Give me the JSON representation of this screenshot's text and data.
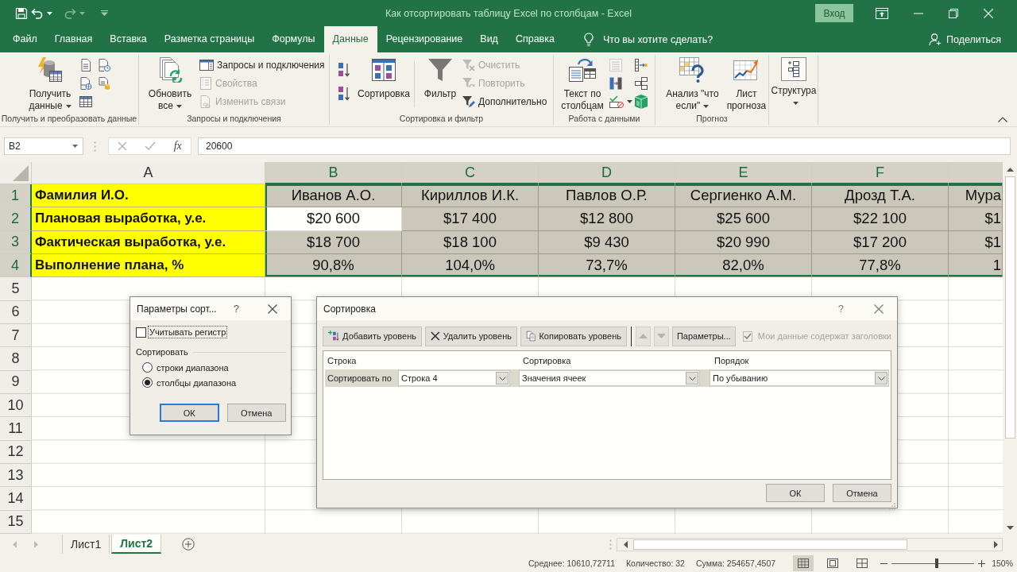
{
  "window": {
    "title": "Как отсортировать таблицу Excel по столбцам - Excel",
    "sign_in": "Вход"
  },
  "quick_access": [
    {
      "kind": "save",
      "disabled": false
    },
    {
      "kind": "undo",
      "disabled": false
    },
    {
      "kind": "redo",
      "disabled": true
    }
  ],
  "tabs": [
    {
      "label": "Файл",
      "selected": false
    },
    {
      "label": "Главная",
      "selected": false
    },
    {
      "label": "Вставка",
      "selected": false
    },
    {
      "label": "Разметка страницы",
      "selected": false
    },
    {
      "label": "Формулы",
      "selected": false
    },
    {
      "label": "Данные",
      "selected": true
    },
    {
      "label": "Рецензирование",
      "selected": false
    },
    {
      "label": "Вид",
      "selected": false
    },
    {
      "label": "Справка",
      "selected": false
    }
  ],
  "tell_me": {
    "placeholder": "Что вы хотите сделать?"
  },
  "share": "Поделиться",
  "ribbon": [
    {
      "label": "Получить и преобразовать данные",
      "buttons": [
        {
          "label": "Получить данные",
          "caret": true,
          "disabled": false
        }
      ]
    },
    {
      "label": "Запросы и подключения",
      "buttons": [
        {
          "label": "Обновить все",
          "caret": true,
          "disabled": false
        },
        {
          "label": "Запросы и подключения",
          "caret": false,
          "disabled": false
        },
        {
          "label": "Свойства",
          "caret": false,
          "disabled": true
        },
        {
          "label": "Изменить связи",
          "caret": false,
          "disabled": true
        }
      ]
    },
    {
      "label": "Сортировка и фильтр",
      "buttons": [
        {
          "label": "Сортировка",
          "caret": false,
          "disabled": false
        },
        {
          "label": "Фильтр",
          "caret": false,
          "disabled": false
        },
        {
          "label": "Очистить",
          "caret": false,
          "disabled": true
        },
        {
          "label": "Повторить",
          "caret": false,
          "disabled": true
        },
        {
          "label": "Дополнительно",
          "caret": false,
          "disabled": false
        }
      ]
    },
    {
      "label": "Работа с данными",
      "buttons": [
        {
          "label": "Текст по столбцам",
          "caret": false,
          "disabled": false
        }
      ],
      "icon_buttons": [
        {
          "disabled": true,
          "caret": false
        },
        {
          "disabled": false,
          "caret": false
        },
        {
          "disabled": false,
          "caret": false
        },
        {
          "disabled": false,
          "caret": false
        },
        {
          "disabled": false,
          "caret": true
        },
        {
          "disabled": false,
          "caret": false
        }
      ]
    },
    {
      "label": "Прогноз",
      "buttons": [
        {
          "label": "Анализ \"что если\"",
          "caret": true,
          "disabled": false
        },
        {
          "label": "Лист прогноза",
          "caret": false,
          "disabled": false
        }
      ]
    },
    {
      "buttons": [
        {
          "label": "Структура",
          "caret": true,
          "disabled": false
        }
      ]
    }
  ],
  "formula_bar": {
    "name_box": "B2",
    "function_button": "fx",
    "value": "20600"
  },
  "sheet": {
    "columns": [
      {
        "label": "A",
        "selected": false
      },
      {
        "label": "B",
        "selected": true
      },
      {
        "label": "C",
        "selected": true
      },
      {
        "label": "D",
        "selected": true
      },
      {
        "label": "E",
        "selected": true
      },
      {
        "label": "F",
        "selected": true
      },
      {
        "selected": true
      }
    ],
    "rows": [
      {
        "number": "1",
        "selected": true,
        "cells": [
          {
            "text": "Фамилия И.О.",
            "active": false
          },
          {
            "text": "Иванов А.О.",
            "active": false
          },
          {
            "text": "Кириллов И.К.",
            "active": false
          },
          {
            "text": "Павлов О.Р.",
            "active": false
          },
          {
            "text": "Сергиенко А.М.",
            "active": false
          },
          {
            "text": "Дрозд Т.А.",
            "active": false
          },
          {
            "text": "Мура",
            "active": false
          }
        ]
      },
      {
        "number": "2",
        "selected": true,
        "cells": [
          {
            "text": "Плановая выработка, у.е.",
            "active": false
          },
          {
            "text": "$20 600",
            "active": true
          },
          {
            "text": "$17 400",
            "active": false
          },
          {
            "text": "$12 800",
            "active": false
          },
          {
            "text": "$25 600",
            "active": false
          },
          {
            "text": "$22 100",
            "active": false
          },
          {
            "text": "$1",
            "active": false
          }
        ]
      },
      {
        "number": "3",
        "selected": true,
        "cells": [
          {
            "text": "Фактическая выработка, у.е.",
            "active": false
          },
          {
            "text": "$18 700",
            "active": false
          },
          {
            "text": "$18 100",
            "active": false
          },
          {
            "text": "$9 430",
            "active": false
          },
          {
            "text": "$20 990",
            "active": false
          },
          {
            "text": "$17 200",
            "active": false
          },
          {
            "text": "$1",
            "active": false
          }
        ]
      },
      {
        "number": "4",
        "selected": true,
        "cells": [
          {
            "text": "Выполнение плана, %",
            "active": false
          },
          {
            "text": "90,8%",
            "active": false
          },
          {
            "text": "104,0%",
            "active": false
          },
          {
            "text": "73,7%",
            "active": false
          },
          {
            "text": "82,0%",
            "active": false
          },
          {
            "text": "77,8%",
            "active": false
          },
          {
            "text": "1",
            "active": false
          }
        ]
      },
      {
        "number": "5",
        "selected": false
      },
      {
        "number": "6",
        "selected": false
      },
      {
        "number": "7",
        "selected": false
      },
      {
        "number": "8",
        "selected": false
      },
      {
        "number": "9",
        "selected": false
      },
      {
        "number": "10",
        "selected": false
      },
      {
        "number": "11",
        "selected": false
      },
      {
        "number": "12",
        "selected": false
      },
      {
        "number": "13",
        "selected": false
      },
      {
        "number": "14",
        "selected": false
      },
      {
        "number": "15",
        "selected": false
      }
    ]
  },
  "sheet_tabs": [
    {
      "label": "Лист1",
      "selected": false
    },
    {
      "label": "Лист2",
      "selected": true
    }
  ],
  "status_bar": {
    "average": "Среднее: 10610,72711",
    "count": "Количество: 32",
    "sum": "Сумма: 254657,4507",
    "views": [
      {
        "kind": "normal",
        "selected": true
      },
      {
        "kind": "page_layout",
        "selected": false
      },
      {
        "kind": "page_break",
        "selected": false
      }
    ],
    "zoom": {
      "level": 0.55,
      "label": "150%"
    }
  },
  "options_dialog": {
    "title": "Параметры сорт...",
    "help": "?",
    "case_sensitive": {
      "label": "Учитывать регистр",
      "checked": false
    },
    "group_label": "Сортировать",
    "orientation": [
      {
        "label": "строки диапазона",
        "selected": false
      },
      {
        "label": "столбцы диапазона",
        "selected": true
      }
    ],
    "buttons": [
      {
        "label": "ОК",
        "default": true
      },
      {
        "label": "Отмена",
        "default": false
      }
    ]
  },
  "sort_dialog": {
    "title": "Сортировка",
    "help": "?",
    "toolbar": [
      {
        "kind": "add",
        "label": "Добавить уровень"
      },
      {
        "kind": "delete",
        "label": "Удалить уровень"
      },
      {
        "kind": "copy",
        "label": "Копировать уровень"
      }
    ],
    "move_up": {
      "disabled": true
    },
    "move_down": {
      "disabled": true
    },
    "options_button": "Параметры...",
    "headers_checkbox": {
      "label": "Мои данные содержат заголовки",
      "checked": true,
      "disabled": true
    },
    "columns": [
      "Строка",
      "Сортировка",
      "Порядок"
    ],
    "levels": [
      {
        "label": "Сортировать по",
        "selected": true,
        "row": "Строка 4",
        "sort_on": "Значения ячеек",
        "order": "По убыванию"
      }
    ],
    "buttons": [
      {
        "label": "ОК"
      },
      {
        "label": "Отмена"
      }
    ]
  }
}
